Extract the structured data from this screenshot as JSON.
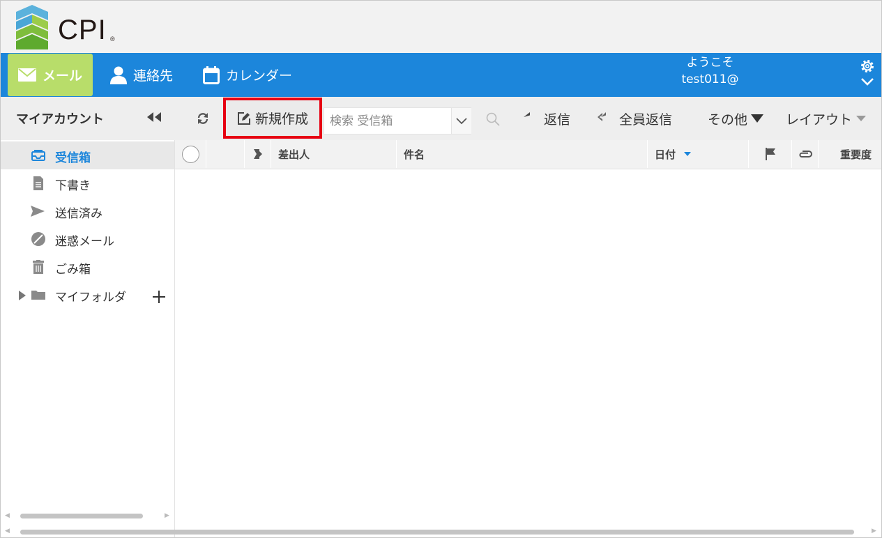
{
  "brand": {
    "logo_text": "CPI",
    "logo_reg": "®",
    "accent": "#1c86db",
    "active_nav": "#b8dd6a",
    "highlight": "#e60012"
  },
  "nav": {
    "mail": "メール",
    "contacts": "連絡先",
    "calendar": "カレンダー"
  },
  "user": {
    "welcome": "ようこそ",
    "name": "test011@"
  },
  "sidebar": {
    "title": "マイアカウント",
    "folders": [
      {
        "label": "受信箱",
        "icon": "inbox-icon",
        "selected": true
      },
      {
        "label": "下書き",
        "icon": "document-icon"
      },
      {
        "label": "送信済み",
        "icon": "send-icon"
      },
      {
        "label": "迷惑メール",
        "icon": "block-icon"
      },
      {
        "label": "ごみ箱",
        "icon": "trash-icon"
      },
      {
        "label": "マイフォルダ",
        "icon": "folder-icon"
      }
    ]
  },
  "toolbar": {
    "compose": "新規作成",
    "search_placeholder": "検索 受信箱",
    "reply": "返信",
    "reply_all": "全員返信",
    "more": "その他",
    "layout": "レイアウト"
  },
  "list_header": {
    "from": "差出人",
    "subject": "件名",
    "date": "日付",
    "priority": "重要度"
  }
}
